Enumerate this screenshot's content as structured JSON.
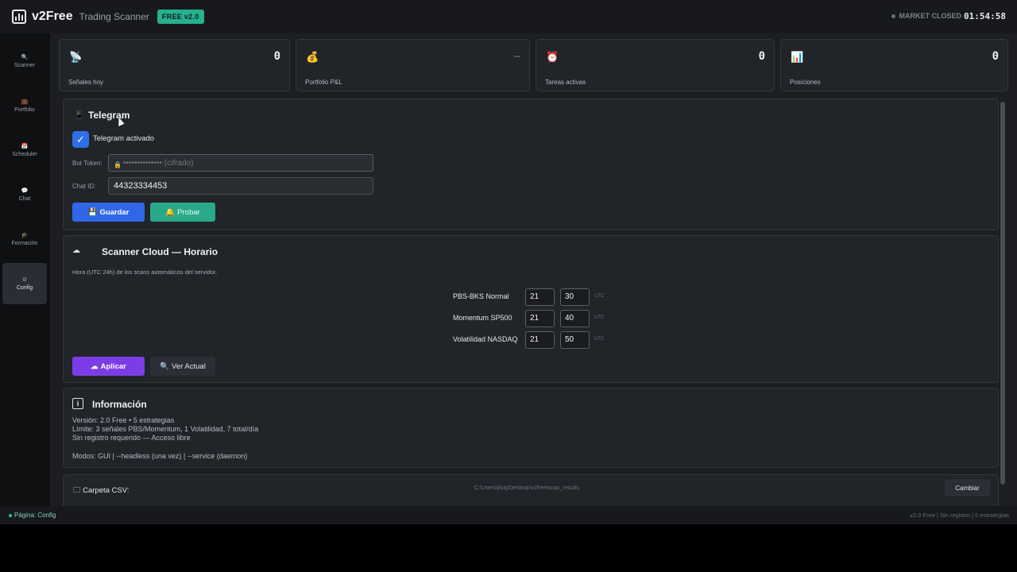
{
  "app": {
    "brand": "v2Free",
    "subtitle": "Trading Scanner",
    "badge": "FREE v2.0",
    "market_status": "MARKET CLOSED",
    "clock": "01:54:58"
  },
  "sidebar": {
    "items": [
      {
        "label": "Scanner",
        "icon": "magnifier-icon",
        "glyph": "🔍"
      },
      {
        "label": "Portfolio",
        "icon": "briefcase-icon",
        "glyph": "💼"
      },
      {
        "label": "Scheduler",
        "icon": "calendar-icon",
        "glyph": "📅"
      },
      {
        "label": "Chat",
        "icon": "chat-icon",
        "glyph": "💬"
      },
      {
        "label": "Formación",
        "icon": "graduation-icon",
        "glyph": "🎓"
      },
      {
        "label": "Config",
        "icon": "gear-icon",
        "glyph": "⚙"
      }
    ],
    "active": "Config"
  },
  "stats": [
    {
      "label": "Señales hoy",
      "value": "0",
      "icon": "signal-icon",
      "glyph": "📡"
    },
    {
      "label": "Portfolio P&L",
      "value": "—",
      "icon": "money-bag-icon",
      "glyph": "💰"
    },
    {
      "label": "Tareas activas",
      "value": "0",
      "icon": "alarm-clock-icon",
      "glyph": "⏰"
    },
    {
      "label": "Posiciones",
      "value": "0",
      "icon": "bar-chart-icon",
      "glyph": "📊"
    }
  ],
  "telegram": {
    "title": "Telegram",
    "enabled_label": "Telegram activado",
    "token_label": "Bot Token:",
    "token_placeholder": "•••••••••••••• (cifrado)",
    "chat_label": "Chat ID:",
    "chat_value": "44323334453",
    "save_label": "Guardar",
    "test_label": "Probar"
  },
  "scheduler": {
    "title": "Scanner Cloud — Horario",
    "description": "Hora (UTC 24h) de los scans automáticos del servidor.",
    "rows": [
      {
        "name": "PBS-BKS Normal",
        "hour": "21",
        "minute": "30",
        "tz": "UTC"
      },
      {
        "name": "Momentum SP500",
        "hour": "21",
        "minute": "40",
        "tz": "UTC"
      },
      {
        "name": "Volatilidad NASDAQ",
        "hour": "21",
        "minute": "50",
        "tz": "UTC"
      }
    ],
    "apply_label": "Aplicar",
    "view_label": "Ver Actual"
  },
  "info": {
    "title": "Información",
    "lines": [
      "Versión: 2.0 Free  •  5 estrategias",
      "Límite: 3 señales PBS/Momentum, 1 Volatilidad, 7 total/día",
      "Sin registro requerido — Acceso libre",
      "Modos: GUI | --headless (una vez) | --service (daemon)"
    ]
  },
  "csv": {
    "label": "Carpeta CSV:",
    "path": "C:\\Users\\jfuig\\Desktop\\v2free\\scan_results",
    "change_label": "Cambiar"
  },
  "status": {
    "left": "Página: Config",
    "right": "v2.0 Free | Sin registro | 5 estrategias"
  },
  "colors": {
    "accent_blue": "#2f67e8",
    "accent_green": "#2aa88a",
    "accent_purple": "#7b3de6",
    "badge": "#27b08f"
  }
}
